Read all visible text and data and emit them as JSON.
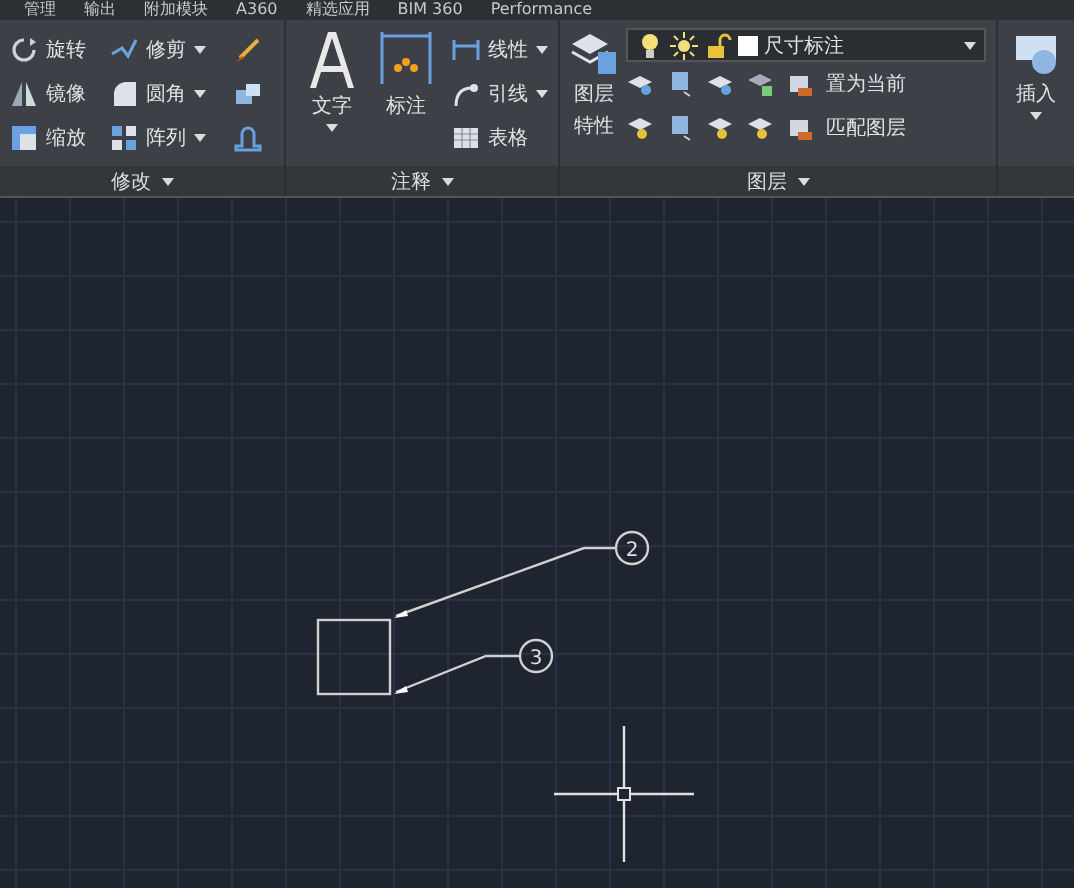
{
  "tabs": [
    {
      "label": "管理"
    },
    {
      "label": "输出"
    },
    {
      "label": "附加模块"
    },
    {
      "label": "A360"
    },
    {
      "label": "精选应用"
    },
    {
      "label": "BIM 360"
    },
    {
      "label": "Performance"
    }
  ],
  "modify": {
    "title": "修改",
    "rows": [
      [
        {
          "kind": "rotate",
          "label": "旋转"
        },
        {
          "kind": "trim",
          "label": "修剪",
          "menu": true
        },
        {
          "kind": "brush"
        }
      ],
      [
        {
          "kind": "mirror",
          "label": "镜像"
        },
        {
          "kind": "fillet",
          "label": "圆角",
          "menu": true
        },
        {
          "kind": "blocks"
        }
      ],
      [
        {
          "kind": "scale",
          "label": "缩放"
        },
        {
          "kind": "array",
          "label": "阵列",
          "menu": true
        },
        {
          "kind": "stretch"
        }
      ]
    ]
  },
  "annotation": {
    "title": "注释",
    "text_tool": {
      "label": "文字",
      "menu": true
    },
    "dim_tool": {
      "label": "标注"
    },
    "small": [
      {
        "kind": "linear",
        "label": "线性",
        "menu": true
      },
      {
        "kind": "leader",
        "label": "引线",
        "menu": true
      },
      {
        "kind": "table",
        "label": "表格",
        "menu": false
      }
    ]
  },
  "layers": {
    "title": "图层",
    "properties": [
      "图层",
      "特性"
    ],
    "current_layer": "尺寸标注",
    "rows": [
      {
        "label": "置为当前"
      },
      {
        "label": "匹配图层"
      }
    ]
  },
  "insert": {
    "label": "插入",
    "menu": true
  },
  "drawing": {
    "callouts": [
      {
        "label": "2"
      },
      {
        "label": "3"
      }
    ]
  }
}
